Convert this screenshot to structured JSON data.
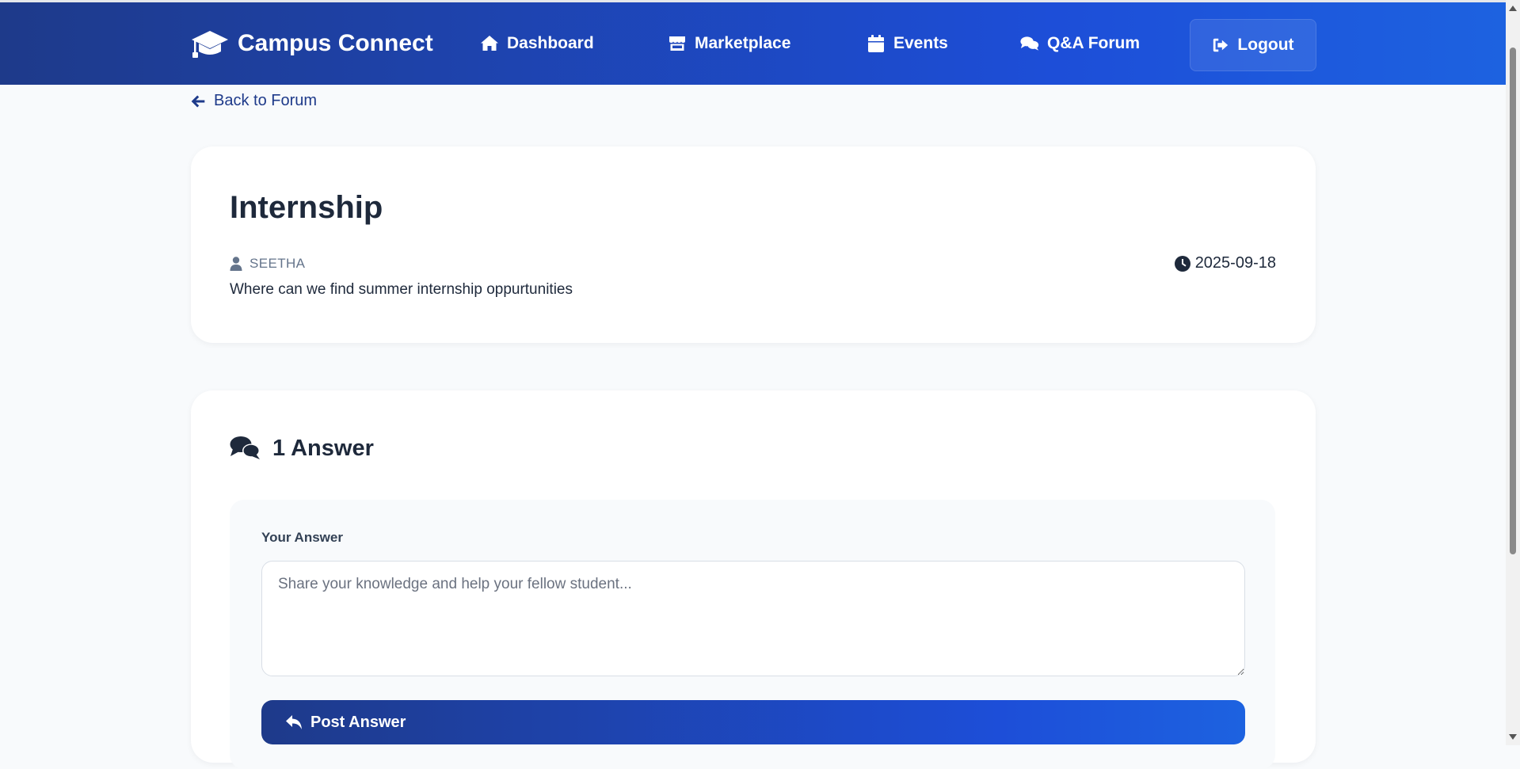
{
  "header": {
    "brand": "Campus Connect",
    "nav": [
      {
        "label": "Dashboard",
        "icon": "home-icon"
      },
      {
        "label": "Marketplace",
        "icon": "store-icon"
      },
      {
        "label": "Events",
        "icon": "calendar-icon"
      },
      {
        "label": "Q&A Forum",
        "icon": "comments-icon"
      }
    ],
    "logout_label": "Logout"
  },
  "back_link": "Back to Forum",
  "question": {
    "title": "Internship",
    "author": "SEETHA",
    "date": "2025-09-18",
    "body": "Where can we find summer internship oppurtunities"
  },
  "answers": {
    "heading": "1 Answer",
    "form": {
      "label": "Your Answer",
      "placeholder": "Share your knowledge and help your fellow student...",
      "value": "",
      "submit_label": "Post Answer"
    }
  },
  "colors": {
    "header_gradient_start": "#1e3a8a",
    "header_gradient_end": "#1d62e0",
    "page_background": "#f8fafc",
    "text_primary": "#1e293b"
  }
}
